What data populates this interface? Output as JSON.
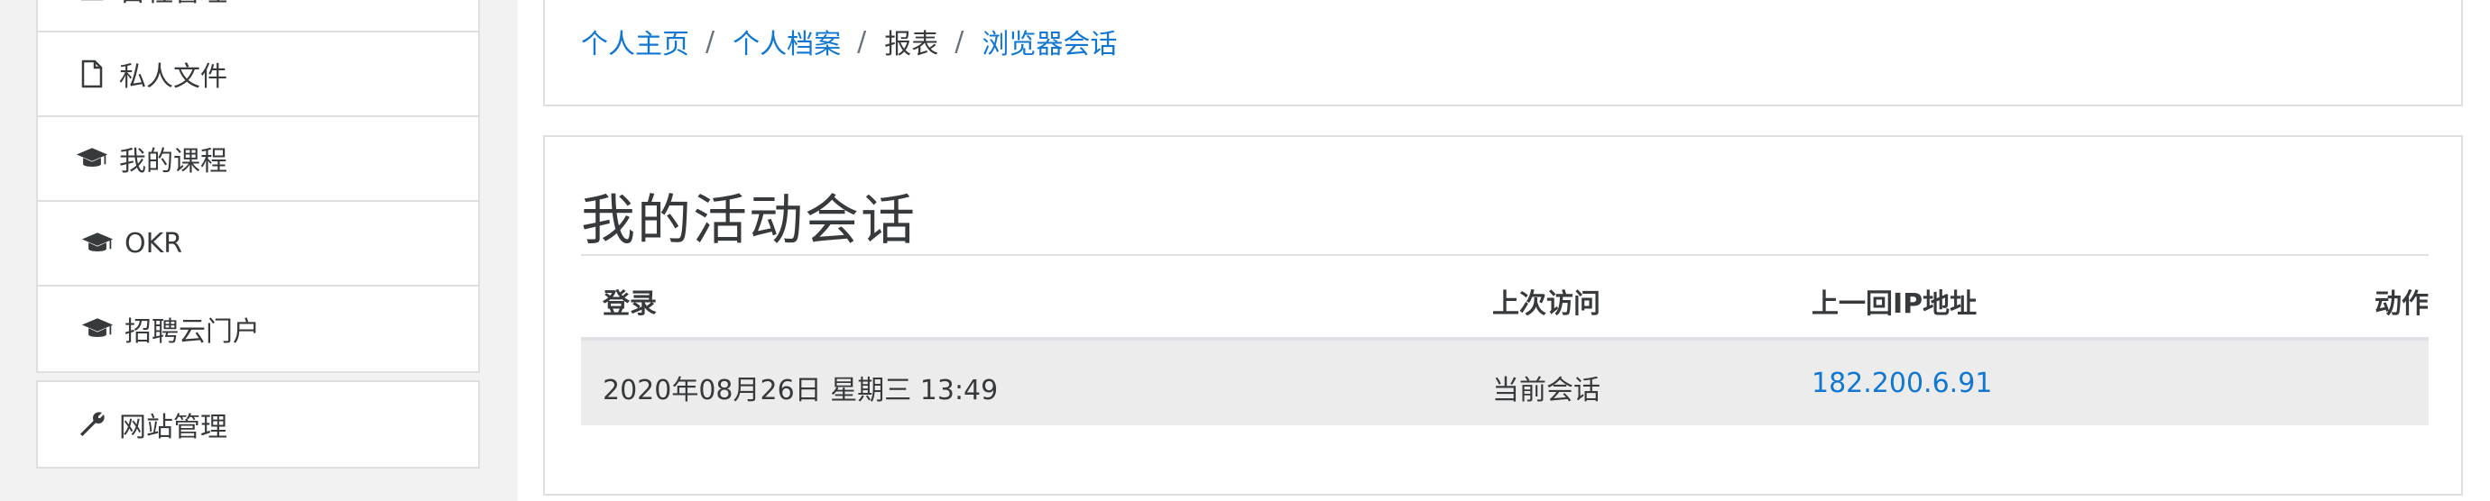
{
  "nav": {
    "top_items": [
      {
        "label": "日程管理",
        "icon": "calendar-icon"
      },
      {
        "label": "私人文件",
        "icon": "file-icon"
      },
      {
        "label": "我的课程",
        "icon": "graduation-cap-icon"
      },
      {
        "label": "OKR",
        "icon": "graduation-cap-icon"
      },
      {
        "label": "招聘云门户",
        "icon": "graduation-cap-icon"
      }
    ],
    "admin_item": {
      "label": "网站管理",
      "icon": "wrench-icon"
    }
  },
  "breadcrumb": {
    "items": [
      {
        "label": "个人主页",
        "link": true
      },
      {
        "label": "个人档案",
        "link": true
      },
      {
        "label": "报表",
        "link": false
      },
      {
        "label": "浏览器会话",
        "link": true
      }
    ],
    "separator": "/"
  },
  "page": {
    "title": "我的活动会话"
  },
  "sessions_table": {
    "headers": {
      "login": "登录",
      "last_access": "上次访问",
      "last_ip": "上一回IP地址",
      "action": "动作"
    },
    "rows": [
      {
        "login": "2020年08月26日 星期三 13:49",
        "last_access": "当前会话",
        "last_ip": "182.200.6.91",
        "action": ""
      }
    ]
  },
  "colors": {
    "link": "#1177d1",
    "text": "#373a3c",
    "row_bg": "#ececec",
    "border": "#dfdfdf"
  }
}
